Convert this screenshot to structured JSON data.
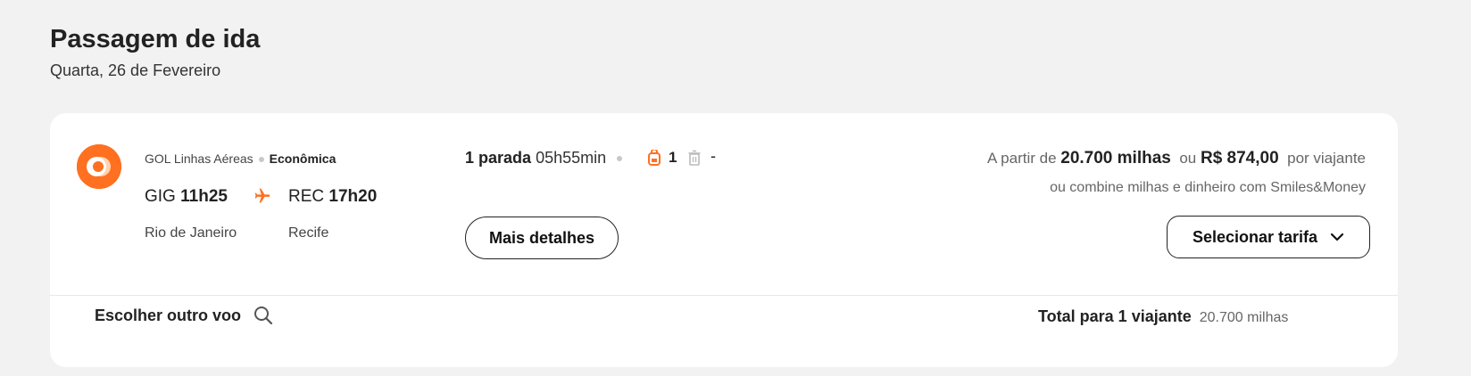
{
  "header": {
    "title": "Passagem de ida",
    "subtitle": "Quarta, 26 de Fevereiro"
  },
  "flight": {
    "airline": "GOL Linhas Aéreas",
    "cabin": "Econômica",
    "origin_code": "GIG",
    "origin_time": "11h25",
    "origin_city": "Rio de Janeiro",
    "dest_code": "REC",
    "dest_time": "17h20",
    "dest_city": "Recife",
    "stops": "1 parada",
    "duration": "05h55min",
    "bags": "1",
    "carry_on": "-",
    "details_label": "Mais detalhes"
  },
  "price": {
    "prefix": "A partir de",
    "miles": "20.700 milhas",
    "or": "ou",
    "money": "R$ 874,00",
    "suffix": "por viajante",
    "combo": "ou combine milhas e dinheiro com Smiles&Money",
    "select_label": "Selecionar tarifa"
  },
  "footer": {
    "other_flight": "Escolher outro voo",
    "total_label": "Total para 1 viajante",
    "total_miles": "20.700 milhas"
  },
  "colors": {
    "accent": "#ff7020",
    "background": "#f2f2f2"
  },
  "icons": [
    "airline-logo-icon",
    "airplane-icon",
    "backpack-icon",
    "trash-icon",
    "chevron-down-icon",
    "search-icon"
  ]
}
